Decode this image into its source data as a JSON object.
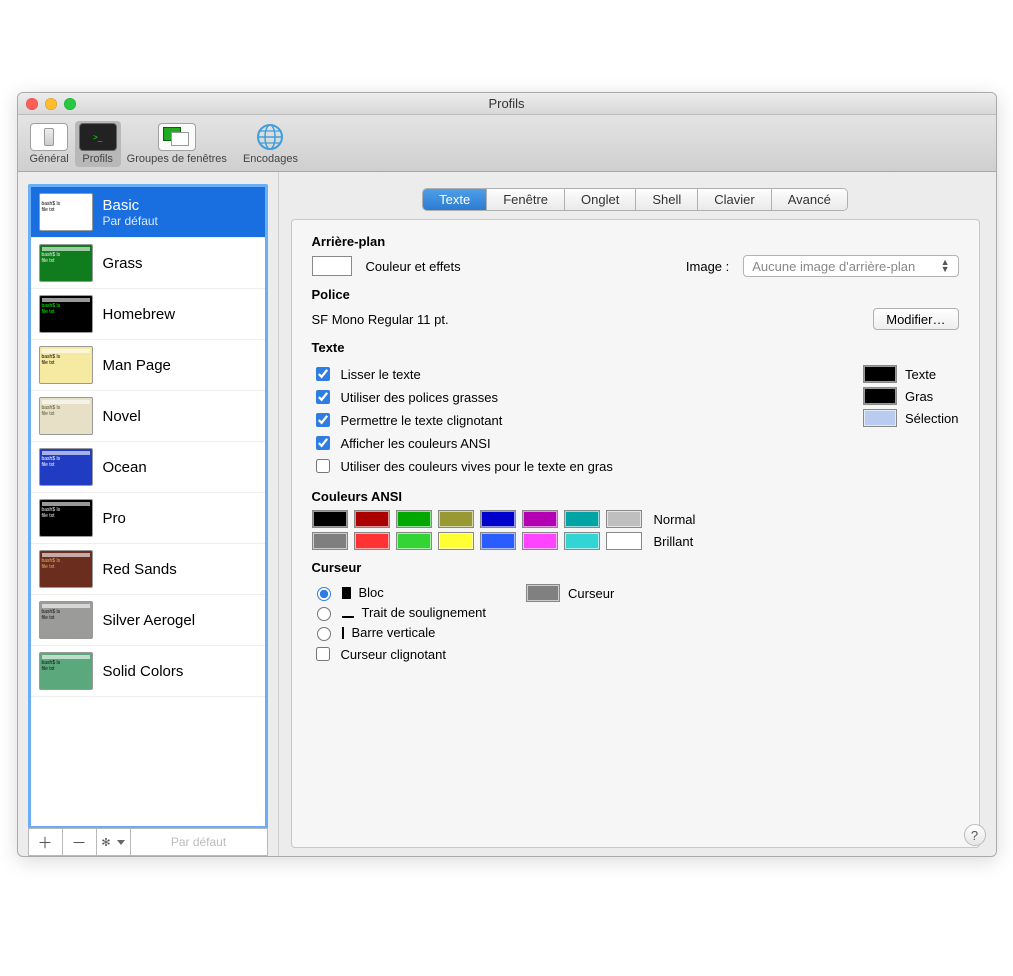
{
  "window": {
    "title": "Profils"
  },
  "traffic": {
    "close": "#ff5f57",
    "min": "#febc2e",
    "max": "#28c840"
  },
  "toolbar": {
    "items": [
      {
        "label": "Général"
      },
      {
        "label": "Profils",
        "selected": true
      },
      {
        "label": "Groupes de fenêtres"
      },
      {
        "label": "Encodages"
      }
    ]
  },
  "profiles": [
    {
      "name": "Basic",
      "sub": "Par défaut",
      "selected": true,
      "bg": "#ffffff",
      "fg": "#000"
    },
    {
      "name": "Grass",
      "bg": "#0f7d1d",
      "fg": "#eee"
    },
    {
      "name": "Homebrew",
      "bg": "#000",
      "fg": "#0f0"
    },
    {
      "name": "Man Page",
      "bg": "#f6e9a2",
      "fg": "#000"
    },
    {
      "name": "Novel",
      "bg": "#e7dfc6",
      "fg": "#553"
    },
    {
      "name": "Ocean",
      "bg": "#1f3cc2",
      "fg": "#fff"
    },
    {
      "name": "Pro",
      "bg": "#000",
      "fg": "#eee"
    },
    {
      "name": "Red Sands",
      "bg": "#6b2d1e",
      "fg": "#d7b36a"
    },
    {
      "name": "Silver Aerogel",
      "bg": "#9b9b99",
      "fg": "#111"
    },
    {
      "name": "Solid Colors",
      "bg": "#5aa87b",
      "fg": "#111"
    }
  ],
  "sidebar_footer": {
    "default_label": "Par défaut"
  },
  "tabs": [
    "Texte",
    "Fenêtre",
    "Onglet",
    "Shell",
    "Clavier",
    "Avancé"
  ],
  "sections": {
    "background": {
      "heading": "Arrière-plan",
      "color_effects": "Couleur et effets",
      "image_label": "Image :",
      "image_popup": "Aucune image d'arrière-plan"
    },
    "font": {
      "heading": "Police",
      "value": "SF Mono Regular 11 pt.",
      "change": "Modifier…"
    },
    "text": {
      "heading": "Texte",
      "smooth": "Lisser le texte",
      "bold_fonts": "Utiliser des polices grasses",
      "blink": "Permettre le texte clignotant",
      "ansi": "Afficher les couleurs ANSI",
      "bright_bold": "Utiliser des couleurs vives pour le texte en gras",
      "right": {
        "text": "Texte",
        "bold": "Gras",
        "selection": "Sélection"
      },
      "swatch_text": "#000000",
      "swatch_bold": "#000000",
      "swatch_sel": "#b9ccf0"
    },
    "ansi": {
      "heading": "Couleurs ANSI",
      "normal_label": "Normal",
      "bright_label": "Brillant",
      "normal": [
        "#000000",
        "#aa0000",
        "#00a800",
        "#999933",
        "#0000cc",
        "#b200b2",
        "#00a4a4",
        "#bfbfbf"
      ],
      "bright": [
        "#7f7f7f",
        "#ff3333",
        "#33d433",
        "#ffff33",
        "#2a5cff",
        "#ff44ff",
        "#33d4d4",
        "#ffffff"
      ]
    },
    "cursor": {
      "heading": "Curseur",
      "block": "Bloc",
      "underline": "Trait de soulignement",
      "vbar": "Barre verticale",
      "blink": "Curseur clignotant",
      "color_label": "Curseur",
      "color": "#808080"
    }
  }
}
